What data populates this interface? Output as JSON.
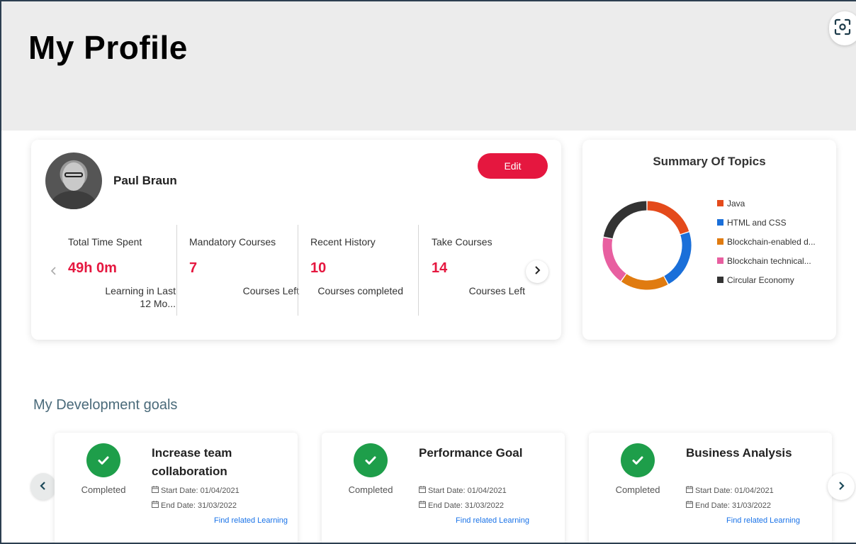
{
  "header": {
    "title": "My Profile"
  },
  "profile": {
    "name": "Paul Braun",
    "edit_label": "Edit",
    "stats": [
      {
        "label": "Total Time Spent",
        "value": "49h 0m",
        "sub": "Learning in Last 12 Mo..."
      },
      {
        "label": "Mandatory Courses",
        "value": "7",
        "sub": "Courses Left"
      },
      {
        "label": "Recent History",
        "value": "10",
        "sub": "Courses completed"
      },
      {
        "label": "Take Courses",
        "value": "14",
        "sub": "Courses Left"
      }
    ],
    "prev_icon": "chevron-left-icon",
    "next_icon": "chevron-right-icon"
  },
  "summary": {
    "title": "Summary Of Topics",
    "topics": [
      {
        "label": "Java",
        "color": "#e44a1b",
        "share": 0.2
      },
      {
        "label": "HTML and CSS",
        "color": "#1a6fd9",
        "share": 0.22
      },
      {
        "label": "Blockchain-enabled d...",
        "color": "#e07b10",
        "share": 0.18
      },
      {
        "label": "Blockchain technical...",
        "color": "#e85fa0",
        "share": 0.18
      },
      {
        "label": "Circular Economy",
        "color": "#333333",
        "share": 0.22
      }
    ]
  },
  "goals": {
    "section_title": "My Development goals",
    "items": [
      {
        "title": "Increase team collaboration",
        "status": "Completed",
        "start": "Start Date: 01/04/2021",
        "end": "End Date: 31/03/2022",
        "link": "Find related Learning"
      },
      {
        "title": "Performance Goal",
        "status": "Completed",
        "start": "Start Date: 01/04/2021",
        "end": "End Date: 31/03/2022",
        "link": "Find related Learning"
      },
      {
        "title": "Business Analysis",
        "status": "Completed",
        "start": "Start Date: 01/04/2021",
        "end": "End Date: 31/03/2022",
        "link": "Find related Learning"
      }
    ]
  },
  "colors": {
    "accent": "#e5173f",
    "success": "#1e9e4a",
    "link": "#1a73e8"
  }
}
